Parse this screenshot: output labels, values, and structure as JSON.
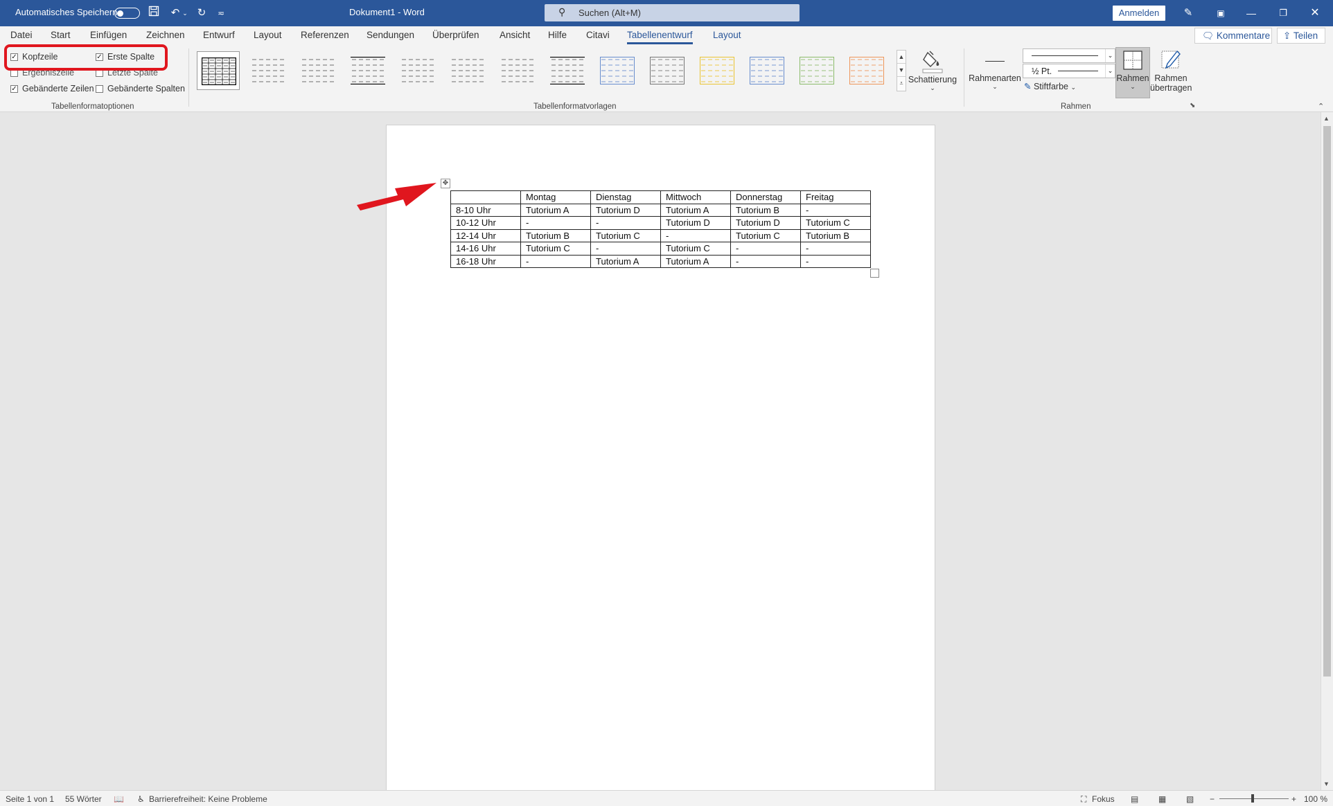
{
  "titlebar": {
    "autosave_label": "Automatisches Speichern",
    "doc_title": "Dokument1  -  Word",
    "search_placeholder": "Suchen (Alt+M)",
    "signin_label": "Anmelden"
  },
  "menu": {
    "tabs": [
      "Datei",
      "Start",
      "Einfügen",
      "Zeichnen",
      "Entwurf",
      "Layout",
      "Referenzen",
      "Sendungen",
      "Überprüfen",
      "Ansicht",
      "Hilfe",
      "Citavi"
    ],
    "active_tab": "Tabellenentwurf",
    "context_tab": "Layout",
    "comments_label": "Kommentare",
    "share_label": "Teilen"
  },
  "ribbon": {
    "options": {
      "header_row": {
        "label": "Kopfzeile",
        "checked": true
      },
      "first_column": {
        "label": "Erste Spalte",
        "checked": true
      },
      "total_row": {
        "label": "Ergebniszeile",
        "checked": false
      },
      "last_column": {
        "label": "Letzte Spalte",
        "checked": false
      },
      "banded_rows": {
        "label": "Gebänderte Zeilen",
        "checked": true
      },
      "banded_columns": {
        "label": "Gebänderte Spalten",
        "checked": false
      },
      "group_label": "Tabellenformatoptionen"
    },
    "styles_group_label": "Tabellenformatvorlagen",
    "shading_label": "Schattierung",
    "border_styles_label": "Rahmenarten",
    "line_weight": "½ Pt.",
    "pen_color_label": "Stiftfarbe",
    "borders_label": "Rahmen",
    "border_painter_label_1": "Rahmen",
    "border_painter_label_2": "übertragen",
    "borders_group_label": "Rahmen"
  },
  "table": {
    "header": [
      "",
      "Montag",
      "Dienstag",
      "Mittwoch",
      "Donnerstag",
      "Freitag"
    ],
    "rows": [
      [
        "8-10 Uhr",
        "Tutorium A",
        "Tutorium D",
        "Tutorium A",
        "Tutorium B",
        "-"
      ],
      [
        "10-12 Uhr",
        "-",
        "-",
        "Tutorium D",
        "Tutorium D",
        "Tutorium C"
      ],
      [
        "12-14 Uhr",
        "Tutorium B",
        "Tutorium C",
        "-",
        "Tutorium C",
        "Tutorium B"
      ],
      [
        "14-16 Uhr",
        "Tutorium C",
        "-",
        "Tutorium C",
        "-",
        "-"
      ],
      [
        "16-18 Uhr",
        "-",
        "Tutorium A",
        "Tutorium A",
        "-",
        "-"
      ]
    ]
  },
  "statusbar": {
    "page": "Seite 1 von 1",
    "words": "55 Wörter",
    "accessibility": "Barrierefreiheit: Keine Probleme",
    "focus": "Fokus",
    "zoom": "100 %"
  },
  "colors": {
    "accent": "#2b579a",
    "annotation": "#e0161e"
  }
}
